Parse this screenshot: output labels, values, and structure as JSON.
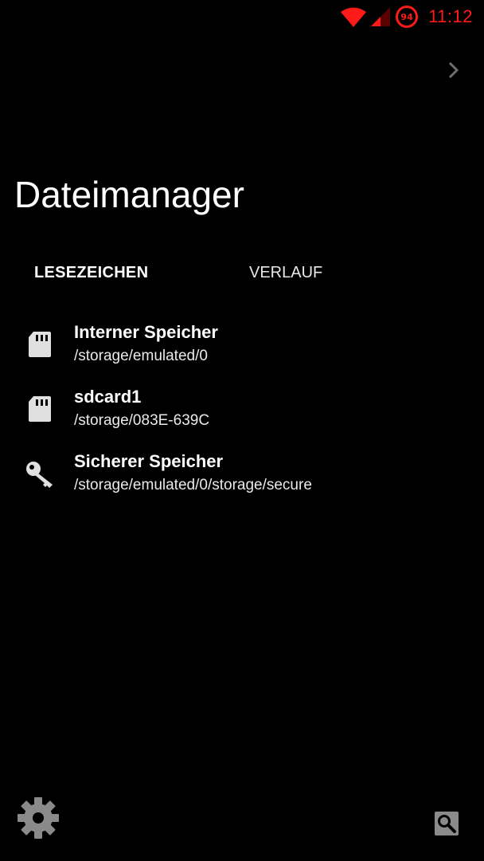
{
  "status_bar": {
    "battery_level": "94",
    "time": "11:12",
    "accent_color": "#ff1a1a",
    "icons": [
      "wifi-icon",
      "cellular-signal-icon",
      "battery-icon"
    ]
  },
  "header": {
    "forward_icon": "chevron-right-icon",
    "title": "Dateimanager"
  },
  "tabs": [
    {
      "label": "LESEZEICHEN",
      "active": true
    },
    {
      "label": "VERLAUF",
      "active": false
    }
  ],
  "bookmarks": [
    {
      "icon": "sd-card-icon",
      "title": "Interner Speicher",
      "path": "/storage/emulated/0"
    },
    {
      "icon": "sd-card-icon",
      "title": "sdcard1",
      "path": "/storage/083E-639C"
    },
    {
      "icon": "key-icon",
      "title": "Sicherer Speicher",
      "path": "/storage/emulated/0/storage/secure"
    }
  ],
  "footer": {
    "settings_icon": "gear-icon",
    "search_icon": "search-icon"
  }
}
